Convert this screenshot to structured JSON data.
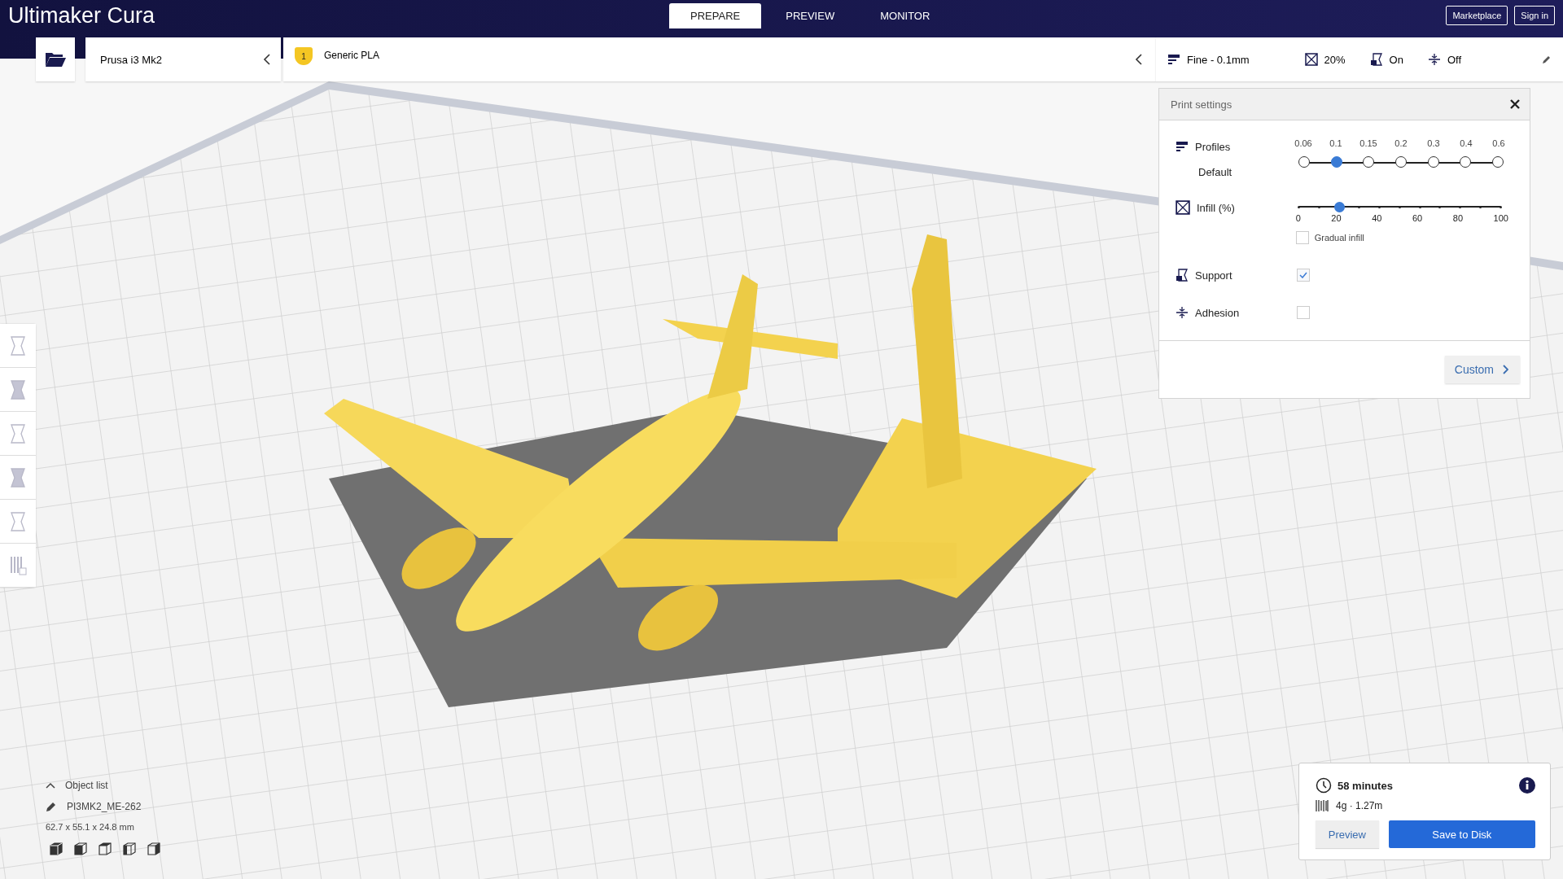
{
  "header": {
    "logo": "Ultimaker Cura",
    "tabs": [
      {
        "label": "PREPARE",
        "selected": true
      },
      {
        "label": "PREVIEW",
        "selected": false
      },
      {
        "label": "MONITOR",
        "selected": false
      }
    ],
    "buttons": [
      "Marketplace",
      "Sign in"
    ]
  },
  "printer": {
    "name": "Prusa i3 Mk2"
  },
  "material": {
    "extruder": "1",
    "name": "Generic PLA"
  },
  "settings_summary": {
    "profile": "Fine - 0.1mm",
    "infill": "20%",
    "support": "On",
    "adhesion": "Off"
  },
  "print_settings": {
    "title": "Print settings",
    "profiles": {
      "label": "Profiles",
      "sublabel": "Default",
      "options": [
        {
          "label": "0.06",
          "selected": false
        },
        {
          "label": "0.1",
          "selected": true
        },
        {
          "label": "0.15",
          "selected": false
        },
        {
          "label": "0.2",
          "selected": false
        },
        {
          "label": "0.3",
          "selected": false
        },
        {
          "label": "0.4",
          "selected": false
        },
        {
          "label": "0.6",
          "selected": false
        }
      ]
    },
    "infill": {
      "label": "Infill (%)",
      "level": 0.2,
      "ticks": [
        "0",
        "20",
        "40",
        "60",
        "80",
        "100"
      ]
    },
    "gradual_infill": {
      "label": "Gradual infill",
      "checked": false
    },
    "support": {
      "label": "Support",
      "checked": true
    },
    "adhesion": {
      "label": "Adhesion",
      "checked": false
    },
    "custom_button": "Custom"
  },
  "object_list": {
    "title": "Object list",
    "object": "PI3MK2_ME-262",
    "dimensions": "62.7 x 55.1 x 24.8 mm"
  },
  "job": {
    "time": "58 minutes",
    "material": "4g · 1.27m",
    "buttons": [
      "Preview",
      "Save to Disk"
    ]
  }
}
